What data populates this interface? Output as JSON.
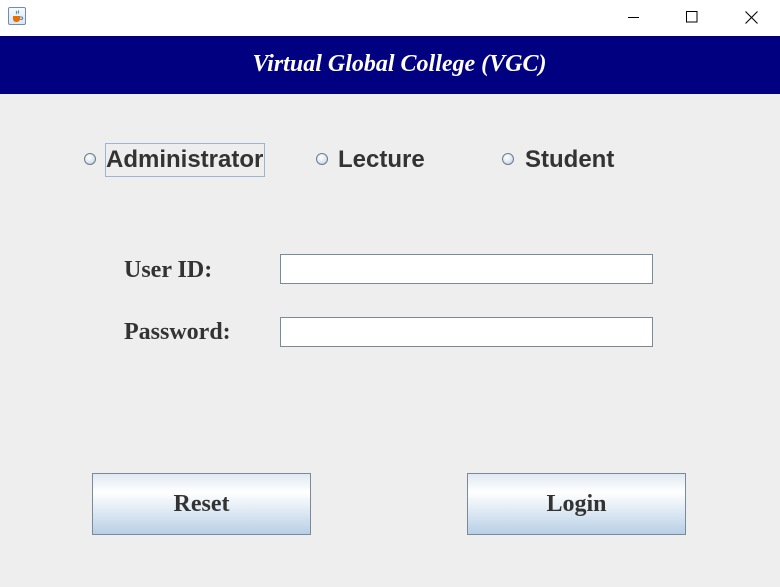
{
  "window": {
    "app_icon": "java-coffee-cup-icon",
    "controls": [
      "minimize-icon",
      "maximize-icon",
      "close-icon"
    ]
  },
  "header": {
    "title": "Virtual Global College (VGC)"
  },
  "roles": [
    {
      "label": "Administrator",
      "selected": false,
      "focused": true
    },
    {
      "label": "Lecture",
      "selected": false,
      "focused": false
    },
    {
      "label": "Student",
      "selected": false,
      "focused": false
    }
  ],
  "form": {
    "user_id_label": "User ID:",
    "user_id_value": "",
    "password_label": "Password:",
    "password_value": ""
  },
  "buttons": {
    "reset": "Reset",
    "login": "Login"
  },
  "colors": {
    "header_bg": "#000080",
    "header_text": "#ffffff",
    "window_bg": "#eeeeee"
  }
}
